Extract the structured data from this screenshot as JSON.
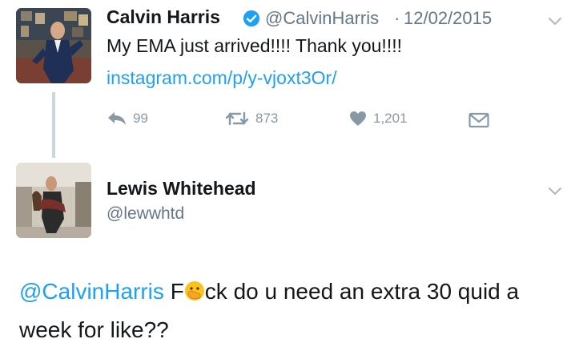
{
  "tweet1": {
    "name": "Calvin Harris",
    "verified_icon": "verified-badge-icon",
    "handle": "@CalvinHarris",
    "separator": "·",
    "date": "12/02/2015",
    "text": "My EMA just arrived!!!! Thank you!!!!",
    "link": "instagram.com/p/y-vjoxt3Or/",
    "actions": {
      "reply_count": "99",
      "retweet_count": "873",
      "like_count": "1,201"
    }
  },
  "tweet2": {
    "name": "Lewis Whitehead",
    "handle": "@lewwhtd",
    "mention": "@CalvinHarris",
    "text_part1": "F",
    "emoji_icon": "hand-over-mouth-emoji",
    "text_part2": "ck do u need an extra 30 quid a week for like??"
  },
  "colors": {
    "link": "#1da1f2",
    "secondary": "#657786",
    "action": "#8899a6",
    "verified": "#1da1f2",
    "thread_line": "#ccd6dd"
  }
}
